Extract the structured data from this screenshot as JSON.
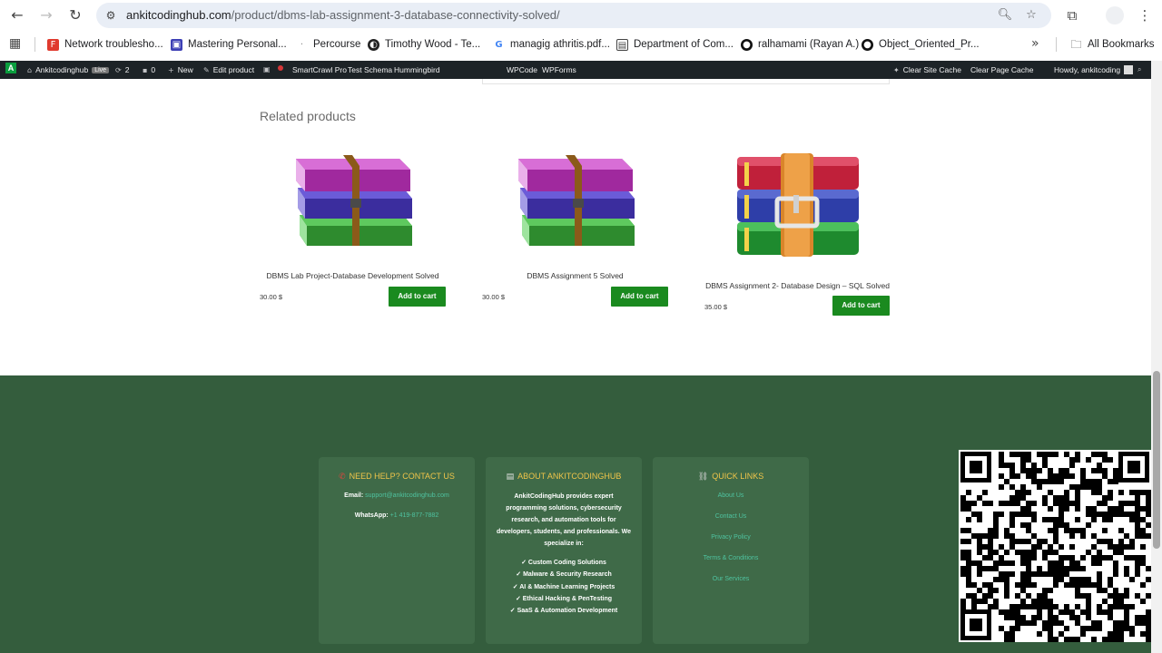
{
  "browser": {
    "url_domain": "ankitcodinghub.com",
    "url_path": "/product/dbms-lab-assignment-3-database-connectivity-solved/"
  },
  "bookmarks": {
    "items": [
      {
        "label": "Network troublesho...",
        "icon": "f-icon",
        "color": "#e03a2e"
      },
      {
        "label": "Mastering Personal...",
        "icon": "book-icon",
        "color": "#3c3fb5"
      },
      {
        "label": "Percourse",
        "icon": "dot-icon",
        "color": "#888888"
      },
      {
        "label": "Timothy Wood - Te...",
        "icon": "globe-icon",
        "color": "#222222"
      },
      {
        "label": "managig athritis.pdf...",
        "icon": "google-icon",
        "color": "#4285f4"
      },
      {
        "label": "Department of Com...",
        "icon": "building-icon",
        "color": "#444444"
      },
      {
        "label": "ralhamami (Rayan A.)",
        "icon": "github-icon",
        "color": "#111111"
      },
      {
        "label": "Object_Oriented_Pr...",
        "icon": "github-icon",
        "color": "#111111"
      }
    ],
    "all_bookmarks": "All Bookmarks"
  },
  "wpbar": {
    "site_name": "Ankitcodinghub",
    "live": "Live",
    "updates": "2",
    "comments": "0",
    "new": "New",
    "edit_product": "Edit product",
    "smartcrawl": "SmartCrawl Pro",
    "test_schema": "Test Schema",
    "hummingbird": "Hummingbird",
    "wpcode": "WPCode",
    "wpforms": "WPForms",
    "clear_site_cache": "Clear Site Cache",
    "clear_page_cache": "Clear Page Cache",
    "howdy": "Howdy, ankitcoding"
  },
  "related": {
    "title": "Related products",
    "products": [
      {
        "title": "DBMS Lab Project-Database Development Solved",
        "price": "30.00 $",
        "button": "Add to cart",
        "image": "winrar-purple-icon"
      },
      {
        "title": "DBMS Assignment 5 Solved",
        "price": "30.00 $",
        "button": "Add to cart",
        "image": "winrar-purple-icon"
      },
      {
        "title": "DBMS Assignment 2- Database Design – SQL Solved",
        "price": "35.00 $",
        "button": "Add to cart",
        "image": "winrar-classic-icon"
      }
    ]
  },
  "footer": {
    "contact": {
      "heading": "NEED HELP? CONTACT US",
      "email_label": "Email:",
      "email": "support@ankitcodinghub.com",
      "whatsapp_label": "WhatsApp:",
      "whatsapp": "+1 419-877-7882"
    },
    "about": {
      "heading": "ABOUT ANKITCODINGHUB",
      "text": "AnkitCodingHub provides expert programming solutions, cybersecurity research, and automation tools for developers, students, and professionals. We specialize in:",
      "items": [
        "✓ Custom Coding Solutions",
        "✓ Malware & Security Research",
        "✓ AI & Machine Learning Projects",
        "✓ Ethical Hacking & PenTesting",
        "✓ SaaS & Automation Development"
      ]
    },
    "quick_links": {
      "heading": "QUICK LINKS",
      "links": [
        "About Us",
        "Contact Us",
        "Privacy Policy",
        "Terms & Conditions",
        "Our Services"
      ]
    }
  },
  "colors": {
    "cart_button": "#1a8a1f",
    "footer_bg": "#345d3d",
    "footer_heading": "#f0c54a",
    "footer_link": "#4fc3a0"
  }
}
